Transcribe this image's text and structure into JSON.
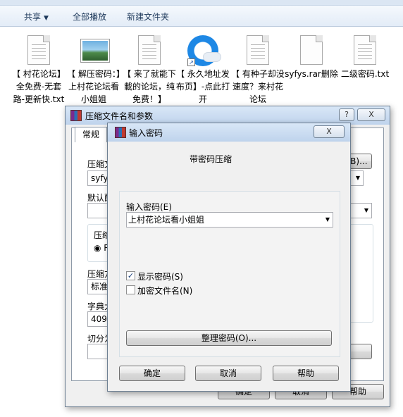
{
  "explorer": {
    "toolbar": {
      "share_label": "共享",
      "burn_label": "全部播放",
      "new_folder_label": "新建文件夹"
    },
    "files": [
      {
        "name": "【 村花论坛】全免费-无套路-更新快.txt",
        "icon": "text-document-icon"
      },
      {
        "name": "【 解压密码：】上村花论坛看小姐姐",
        "icon": "image-icon"
      },
      {
        "name": "【 来了就能下載的论坛，纯免费！】",
        "icon": "text-document-icon"
      },
      {
        "name": "【 永久地址发布页】-点此打开",
        "icon": "browser-shortcut-icon"
      },
      {
        "name": "【 有种子却没速度？来村花论坛",
        "icon": "text-document-icon"
      },
      {
        "name": "syfys.rar删除",
        "icon": "blank-document-icon"
      },
      {
        "name": "二级密码.txt",
        "icon": "text-document-icon"
      }
    ]
  },
  "compress_dialog": {
    "title": "压缩文件名和参数",
    "help_btn": "?",
    "close_btn": "X",
    "tab_general": "常规",
    "archive_name_label": "压缩文件名(A)",
    "archive_name_value": "syfys",
    "browse_btn": "浏览(B)...",
    "default_profile_label": "默认配置",
    "compress_format_label": "压缩文件格式",
    "format_option": "RAR",
    "method_label": "压缩方式(C)",
    "method_value": "标准",
    "dict_label": "字典大小(I)",
    "dict_value": "4096 KB",
    "split_label": "切分为分卷(V)，大小",
    "ok_btn": "确定",
    "cancel_btn": "取消",
    "help_bottom_btn": "帮助"
  },
  "password_dialog": {
    "title": "输入密码",
    "close_btn": "X",
    "heading": "带密码压缩",
    "password_label": "输入密码(E)",
    "password_value": "上村花论坛看小姐姐",
    "show_password_label": "显示密码(S)",
    "show_password_checked": true,
    "encrypt_names_label": "加密文件名(N)",
    "encrypt_names_checked": false,
    "organize_btn": "整理密码(O)...",
    "ok_btn": "确定",
    "cancel_btn": "取消",
    "help_btn": "帮助"
  }
}
